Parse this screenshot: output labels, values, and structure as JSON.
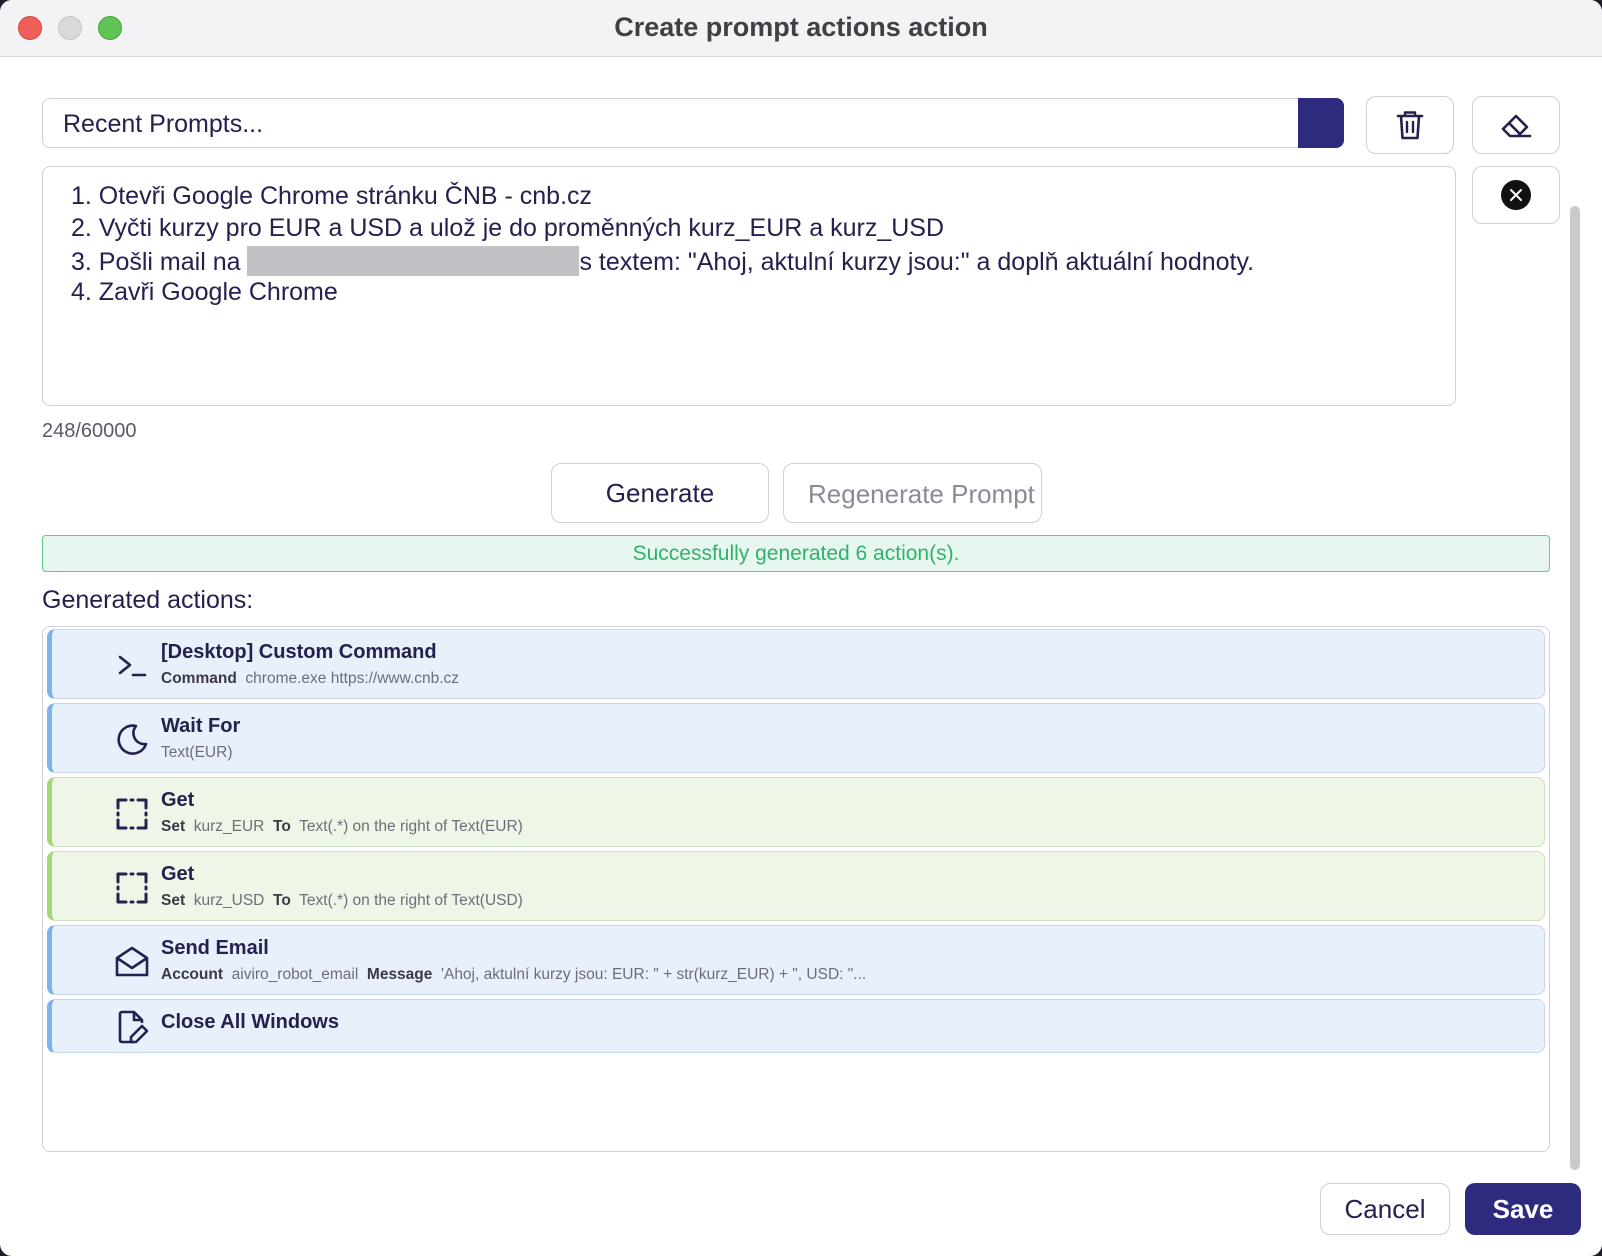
{
  "window": {
    "title": "Create prompt actions action"
  },
  "recent_prompts": {
    "placeholder": "Recent Prompts..."
  },
  "toolbar": {
    "delete_icon": "trash-icon",
    "clear_icon": "eraser-icon",
    "close_icon": "close-circle-icon"
  },
  "prompt": {
    "lines": [
      "1. Otevři Google Chrome stránku ČNB - cnb.cz",
      "2. Vyčti kurzy pro EUR a USD a ulož je do proměnných kurz_EUR a kurz_USD",
      {
        "before": "3. Pošli mail na ",
        "after": "s textem: \"Ahoj, aktulní kurzy jsou:\" a doplň aktuální hodnoty."
      },
      "4. Zavři Google Chrome"
    ],
    "counter": "248/60000"
  },
  "buttons": {
    "generate": "Generate",
    "regenerate": "Regenerate Prompt",
    "cancel": "Cancel",
    "save": "Save"
  },
  "status_message": "Successfully generated 6 action(s).",
  "generated_label": "Generated actions:",
  "actions": [
    {
      "icon": "terminal-icon",
      "color": "blue",
      "name": "[Desktop] Custom Command",
      "key1": "Command",
      "val1": "chrome.exe https://www.cnb.cz",
      "key2": "",
      "val2": ""
    },
    {
      "icon": "moon-icon",
      "color": "blue",
      "name": "Wait For",
      "key1": "",
      "val1": "Text(EUR)",
      "key2": "",
      "val2": ""
    },
    {
      "icon": "focus-frame-icon",
      "color": "green",
      "name": "Get",
      "key1": "Set",
      "val1": "kurz_EUR",
      "key2": "To",
      "val2": "Text(.*) on the right of Text(EUR)"
    },
    {
      "icon": "focus-frame-icon",
      "color": "green",
      "name": "Get",
      "key1": "Set",
      "val1": "kurz_USD",
      "key2": "To",
      "val2": "Text(.*) on the right of Text(USD)"
    },
    {
      "icon": "mail-open-icon",
      "color": "blue",
      "name": "Send Email",
      "key1": "Account",
      "val1": "aiviro_robot_email",
      "key2": "Message",
      "val2": "'Ahoj, aktulní kurzy jsou: EUR: \" + str(kurz_EUR) + \", USD: \"..."
    },
    {
      "icon": "file-pen-icon",
      "color": "blue",
      "name": "Close All Windows",
      "key1": "",
      "val1": "",
      "key2": "",
      "val2": ""
    }
  ],
  "colors": {
    "accent": "#2e2a7d",
    "success_text": "#2eb36b",
    "success_bg": "#e7f6ee",
    "action_blue": "#e7f0fb",
    "action_green": "#eef6e7"
  }
}
